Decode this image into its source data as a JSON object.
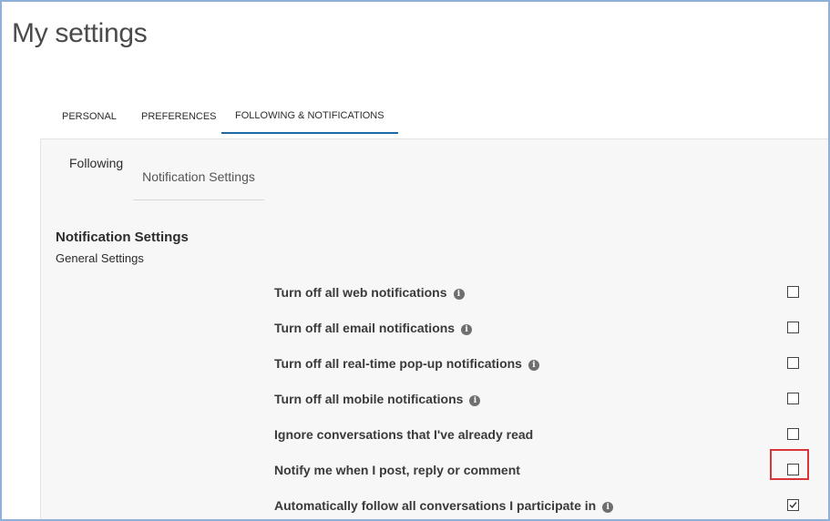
{
  "page": {
    "title": "My settings"
  },
  "tabs": [
    {
      "label": "PERSONAL",
      "active": false
    },
    {
      "label": "PREFERENCES",
      "active": false
    },
    {
      "label": "FOLLOWING & NOTIFICATIONS",
      "active": true
    }
  ],
  "subtabs": [
    {
      "label": "Following",
      "active": false
    },
    {
      "label": "Notification Settings",
      "active": true
    }
  ],
  "section": {
    "title": "Notification Settings",
    "subtitle": "General Settings"
  },
  "settings": [
    {
      "label": "Turn off all web notifications",
      "info": true,
      "checked": false
    },
    {
      "label": "Turn off all email notifications",
      "info": true,
      "checked": false
    },
    {
      "label": "Turn off all real-time pop-up notifications",
      "info": true,
      "checked": false
    },
    {
      "label": "Turn off all mobile notifications",
      "info": true,
      "checked": false
    },
    {
      "label": "Ignore conversations that I've already read",
      "info": false,
      "checked": false
    },
    {
      "label": "Notify me when I post, reply or comment",
      "info": false,
      "checked": false,
      "highlighted": true
    },
    {
      "label": "Automatically follow all conversations I participate in",
      "info": true,
      "checked": true
    }
  ],
  "colors": {
    "accent": "#1c6ba6",
    "highlight": "#d9343a",
    "frame": "#8fb0d9"
  }
}
